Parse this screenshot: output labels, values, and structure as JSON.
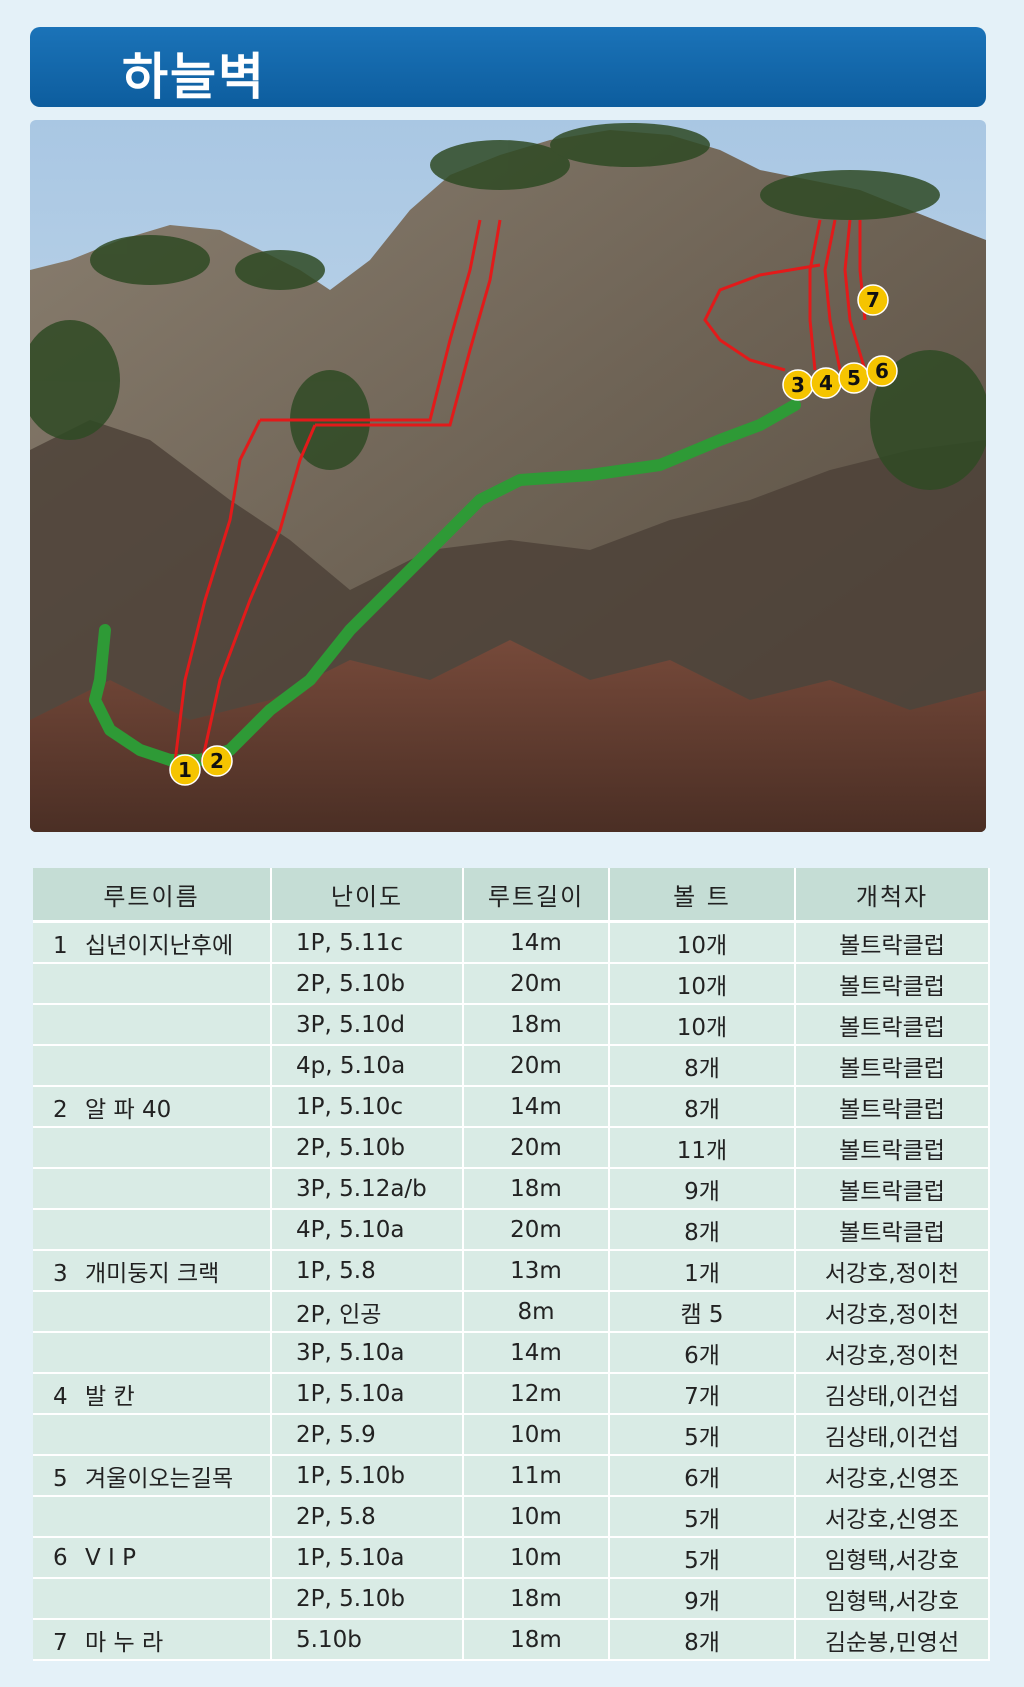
{
  "title": "하늘벽",
  "photo": {
    "markers": [
      "1",
      "2",
      "3",
      "4",
      "5",
      "6",
      "7"
    ]
  },
  "colors": {
    "title_bar": "#0d5d9e",
    "route_line": "#e21a1a",
    "approach_path": "#2e9a36",
    "marker_fill": "#f5c400",
    "table_header": "#c5ddd5",
    "table_row": "#d9ebe5"
  },
  "table": {
    "headers": [
      "루트이름",
      "난이도",
      "루트길이",
      "볼 트",
      "개척자"
    ],
    "rows": [
      {
        "num": "1",
        "name": "십년이지난후에",
        "grade": "1P, 5.11c",
        "length": "14m",
        "bolts": "10개",
        "developer": "볼트락클럽"
      },
      {
        "num": "",
        "name": "",
        "grade": "2P, 5.10b",
        "length": "20m",
        "bolts": "10개",
        "developer": "볼트락클럽"
      },
      {
        "num": "",
        "name": "",
        "grade": "3P, 5.10d",
        "length": "18m",
        "bolts": "10개",
        "developer": "볼트락클럽"
      },
      {
        "num": "",
        "name": "",
        "grade": "4p, 5.10a",
        "length": "20m",
        "bolts": "8개",
        "developer": "볼트락클럽"
      },
      {
        "num": "2",
        "name": "알 파 40",
        "grade": "1P, 5.10c",
        "length": "14m",
        "bolts": "8개",
        "developer": "볼트락클럽"
      },
      {
        "num": "",
        "name": "",
        "grade": "2P, 5.10b",
        "length": "20m",
        "bolts": "11개",
        "developer": "볼트락클럽"
      },
      {
        "num": "",
        "name": "",
        "grade": "3P, 5.12a/b",
        "length": "18m",
        "bolts": "9개",
        "developer": "볼트락클럽"
      },
      {
        "num": "",
        "name": "",
        "grade": "4P, 5.10a",
        "length": "20m",
        "bolts": "8개",
        "developer": "볼트락클럽"
      },
      {
        "num": "3",
        "name": "개미둥지 크랙",
        "grade": "1P, 5.8",
        "length": "13m",
        "bolts": "1개",
        "developer": "서강호,정이천"
      },
      {
        "num": "",
        "name": "",
        "grade": "2P, 인공",
        "length": "8m",
        "bolts": "캠 5",
        "developer": "서강호,정이천"
      },
      {
        "num": "",
        "name": "",
        "grade": "3P, 5.10a",
        "length": "14m",
        "bolts": "6개",
        "developer": "서강호,정이천"
      },
      {
        "num": "4",
        "name": "발    칸",
        "grade": "1P, 5.10a",
        "length": "12m",
        "bolts": "7개",
        "developer": "김상태,이건섭"
      },
      {
        "num": "",
        "name": "",
        "grade": "2P, 5.9",
        "length": "10m",
        "bolts": "5개",
        "developer": "김상태,이건섭"
      },
      {
        "num": "5",
        "name": "겨울이오는길목",
        "grade": "1P, 5.10b",
        "length": "11m",
        "bolts": "6개",
        "developer": "서강호,신영조"
      },
      {
        "num": "",
        "name": "",
        "grade": "2P, 5.8",
        "length": "10m",
        "bolts": "5개",
        "developer": "서강호,신영조"
      },
      {
        "num": "6",
        "name": "V  I  P",
        "grade": "1P, 5.10a",
        "length": "10m",
        "bolts": "5개",
        "developer": "임형택,서강호"
      },
      {
        "num": "",
        "name": "",
        "grade": "2P, 5.10b",
        "length": "18m",
        "bolts": "9개",
        "developer": "임형택,서강호"
      },
      {
        "num": "7",
        "name": "마 누 라",
        "grade": "5.10b",
        "length": "18m",
        "bolts": "8개",
        "developer": "김순봉,민영선"
      }
    ]
  }
}
